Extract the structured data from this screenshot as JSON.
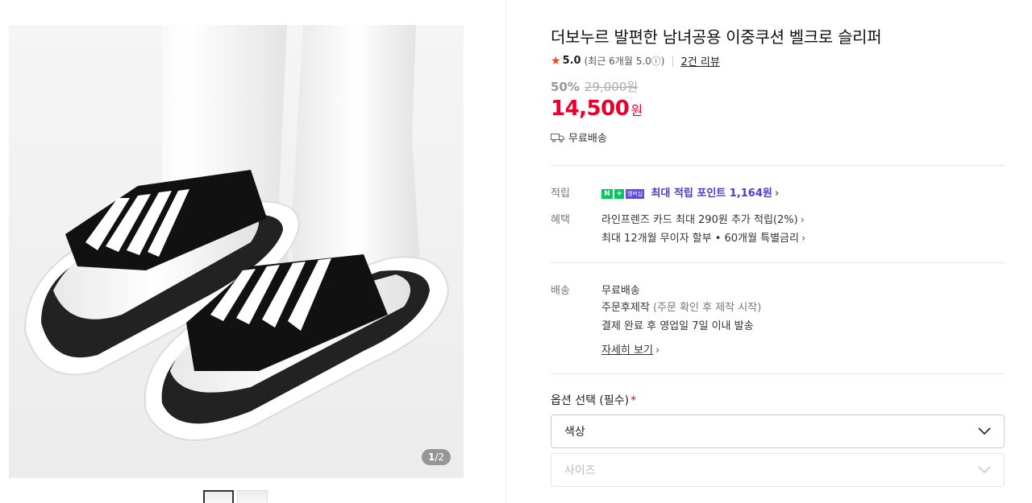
{
  "gallery": {
    "pager_current": "1",
    "pager_total": "/2",
    "prev_arrow": "‹",
    "next_arrow": "›"
  },
  "product": {
    "title": "더보누르 발편한 남녀공용 이중쿠션 벨크로 슬리퍼",
    "rating": "5.0",
    "recent_rating": "(최근 6개월 5.0ⓘ)",
    "review_link": "2건 리뷰",
    "discount_rate": "50%",
    "original_price": "29,000원",
    "sale_price": "14,500",
    "currency": "원",
    "shipping_short": "무료배송"
  },
  "benefits": {
    "points_label": "적립",
    "badge_n": "N",
    "badge_plus": "+",
    "badge_member": "멤버십",
    "points_text": "최대 적립 포인트 1,164원",
    "benefit_label": "혜택",
    "benefit_line1": "라인프렌즈 카드 최대 290원 추가 적립(2%)",
    "benefit_line2": "최대 12개월 무이자 할부 • 60개월 특별금리"
  },
  "delivery": {
    "label": "배송",
    "line1": "무료배송",
    "line2_main": "주문후제작",
    "line2_sub": "(주문 확인 후 제작 시작)",
    "line3": "결제 완료 후 영업일 7일 이내 발송",
    "details_link": "자세히 보기"
  },
  "options": {
    "title": "옵션 선택 (필수)",
    "required_mark": "*",
    "color_select": "색상",
    "size_select": "사이즈"
  },
  "colors": {
    "price_red": "#e6002d",
    "star": "#ff3d24",
    "points_purple": "#4a3dd4",
    "naver_green": "#03c75a"
  }
}
